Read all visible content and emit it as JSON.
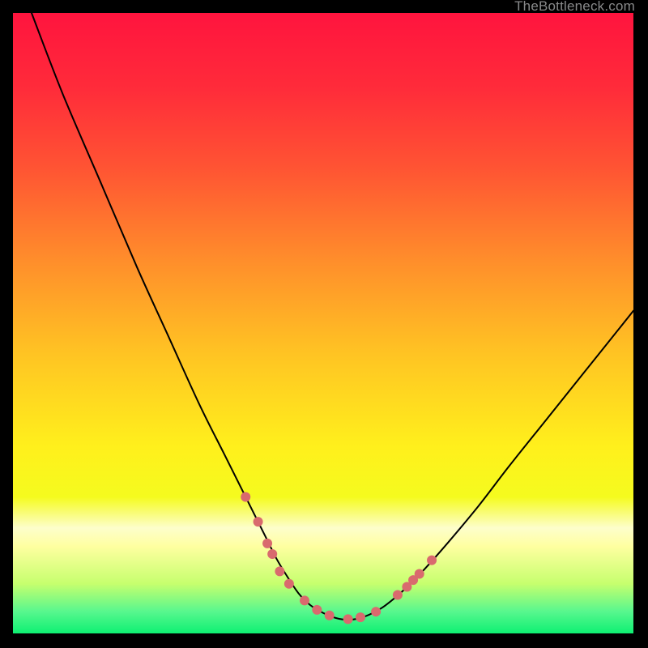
{
  "attribution": "TheBottleneck.com",
  "gradient": {
    "stops": [
      {
        "offset": 0.0,
        "color": "#ff143e"
      },
      {
        "offset": 0.12,
        "color": "#ff2b3a"
      },
      {
        "offset": 0.25,
        "color": "#ff5433"
      },
      {
        "offset": 0.4,
        "color": "#ff8e2b"
      },
      {
        "offset": 0.55,
        "color": "#ffc423"
      },
      {
        "offset": 0.7,
        "color": "#fff01c"
      },
      {
        "offset": 0.78,
        "color": "#f5fb1e"
      },
      {
        "offset": 0.83,
        "color": "#fdfecb"
      },
      {
        "offset": 0.86,
        "color": "#feffa0"
      },
      {
        "offset": 0.92,
        "color": "#c6ff6e"
      },
      {
        "offset": 0.965,
        "color": "#57f78e"
      },
      {
        "offset": 1.0,
        "color": "#0ef072"
      }
    ]
  },
  "chart_data": {
    "type": "line",
    "title": "",
    "xlabel": "",
    "ylabel": "",
    "xlim": [
      0,
      100
    ],
    "ylim": [
      0,
      100
    ],
    "grid": false,
    "series": [
      {
        "name": "bottleneck-curve",
        "x": [
          3,
          8,
          14,
          20,
          25,
          30,
          34,
          37,
          39,
          41,
          42.5,
          44,
          46,
          48,
          50,
          52,
          54,
          56,
          58,
          60,
          63,
          66,
          70,
          75,
          80,
          86,
          92,
          98,
          100
        ],
        "y": [
          100,
          87,
          73,
          59,
          48,
          37,
          29,
          23,
          19,
          15,
          12,
          9.5,
          6.5,
          4.5,
          3.3,
          2.5,
          2.2,
          2.5,
          3.3,
          4.5,
          7,
          10,
          14.5,
          20.5,
          27,
          34.5,
          42,
          49.5,
          52
        ]
      },
      {
        "name": "marker-points",
        "type": "scatter",
        "x": [
          37.5,
          39.5,
          41,
          41.8,
          43,
          44.5,
          47,
          49,
          51,
          54,
          56,
          58.5,
          62,
          63.5,
          64.5,
          65.5,
          67.5
        ],
        "y": [
          22,
          18,
          14.5,
          12.8,
          10,
          8,
          5.3,
          3.8,
          2.9,
          2.3,
          2.6,
          3.5,
          6.2,
          7.5,
          8.6,
          9.6,
          11.8
        ]
      }
    ],
    "marker_style": {
      "color": "#d96a6e",
      "radius": 6
    }
  }
}
